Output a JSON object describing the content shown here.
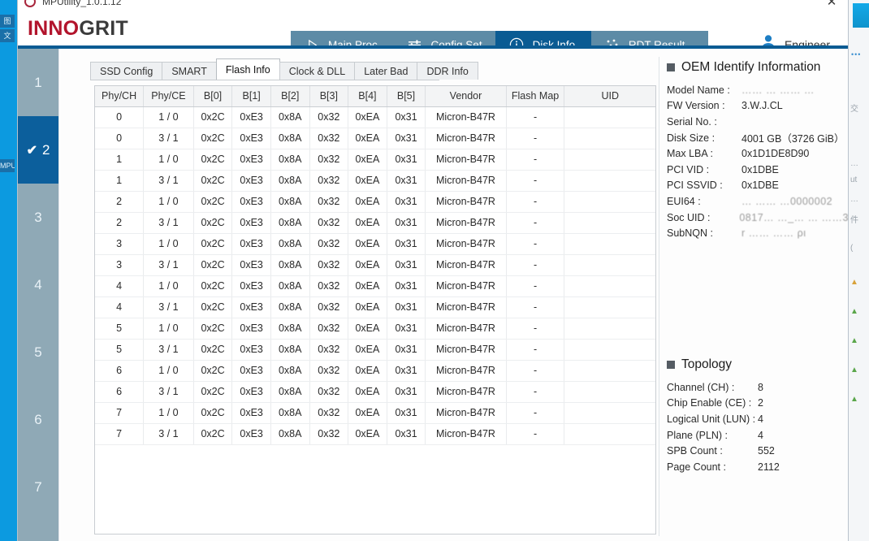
{
  "window": {
    "title": "MPUtility_1.0.1.12",
    "close_label": "✕",
    "logo_red": "INNO",
    "logo_dark": "GRIT"
  },
  "nav": {
    "tabs": [
      {
        "label": "Main Proc.",
        "icon": "play-icon",
        "active": false
      },
      {
        "label": "Config Set",
        "icon": "sliders-icon",
        "active": false
      },
      {
        "label": "Disk Info.",
        "icon": "info-circle-icon",
        "active": true
      },
      {
        "label": "RDT Result",
        "icon": "scatter-dots-icon",
        "active": false
      }
    ],
    "user": {
      "label": "Engineer",
      "icon": "user-avatar-icon"
    }
  },
  "stepper": {
    "steps": [
      {
        "number": "1",
        "active": false,
        "check": ""
      },
      {
        "number": "2",
        "active": true,
        "check": "✔"
      },
      {
        "number": "3",
        "active": false,
        "check": ""
      },
      {
        "number": "4",
        "active": false,
        "check": ""
      },
      {
        "number": "5",
        "active": false,
        "check": ""
      },
      {
        "number": "6",
        "active": false,
        "check": ""
      },
      {
        "number": "7",
        "active": false,
        "check": ""
      }
    ]
  },
  "subtabs": [
    {
      "label": "SSD Config",
      "active": false
    },
    {
      "label": "SMART",
      "active": false
    },
    {
      "label": "Flash Info",
      "active": true
    },
    {
      "label": "Clock & DLL",
      "active": false
    },
    {
      "label": "Later Bad",
      "active": false
    },
    {
      "label": "DDR Info",
      "active": false
    }
  ],
  "flash_table": {
    "headers": [
      "Phy/CH",
      "Phy/CE",
      "B[0]",
      "B[1]",
      "B[2]",
      "B[3]",
      "B[4]",
      "B[5]",
      "Vendor",
      "Flash Map",
      "UID"
    ],
    "rows": [
      [
        "0",
        "1 / 0",
        "0x2C",
        "0xE3",
        "0x8A",
        "0x32",
        "0xEA",
        "0x31",
        "Micron-B47R",
        "-",
        ""
      ],
      [
        "0",
        "3 / 1",
        "0x2C",
        "0xE3",
        "0x8A",
        "0x32",
        "0xEA",
        "0x31",
        "Micron-B47R",
        "-",
        ""
      ],
      [
        "1",
        "1 / 0",
        "0x2C",
        "0xE3",
        "0x8A",
        "0x32",
        "0xEA",
        "0x31",
        "Micron-B47R",
        "-",
        ""
      ],
      [
        "1",
        "3 / 1",
        "0x2C",
        "0xE3",
        "0x8A",
        "0x32",
        "0xEA",
        "0x31",
        "Micron-B47R",
        "-",
        ""
      ],
      [
        "2",
        "1 / 0",
        "0x2C",
        "0xE3",
        "0x8A",
        "0x32",
        "0xEA",
        "0x31",
        "Micron-B47R",
        "-",
        ""
      ],
      [
        "2",
        "3 / 1",
        "0x2C",
        "0xE3",
        "0x8A",
        "0x32",
        "0xEA",
        "0x31",
        "Micron-B47R",
        "-",
        ""
      ],
      [
        "3",
        "1 / 0",
        "0x2C",
        "0xE3",
        "0x8A",
        "0x32",
        "0xEA",
        "0x31",
        "Micron-B47R",
        "-",
        ""
      ],
      [
        "3",
        "3 / 1",
        "0x2C",
        "0xE3",
        "0x8A",
        "0x32",
        "0xEA",
        "0x31",
        "Micron-B47R",
        "-",
        ""
      ],
      [
        "4",
        "1 / 0",
        "0x2C",
        "0xE3",
        "0x8A",
        "0x32",
        "0xEA",
        "0x31",
        "Micron-B47R",
        "-",
        ""
      ],
      [
        "4",
        "3 / 1",
        "0x2C",
        "0xE3",
        "0x8A",
        "0x32",
        "0xEA",
        "0x31",
        "Micron-B47R",
        "-",
        ""
      ],
      [
        "5",
        "1 / 0",
        "0x2C",
        "0xE3",
        "0x8A",
        "0x32",
        "0xEA",
        "0x31",
        "Micron-B47R",
        "-",
        ""
      ],
      [
        "5",
        "3 / 1",
        "0x2C",
        "0xE3",
        "0x8A",
        "0x32",
        "0xEA",
        "0x31",
        "Micron-B47R",
        "-",
        ""
      ],
      [
        "6",
        "1 / 0",
        "0x2C",
        "0xE3",
        "0x8A",
        "0x32",
        "0xEA",
        "0x31",
        "Micron-B47R",
        "-",
        ""
      ],
      [
        "6",
        "3 / 1",
        "0x2C",
        "0xE3",
        "0x8A",
        "0x32",
        "0xEA",
        "0x31",
        "Micron-B47R",
        "-",
        ""
      ],
      [
        "7",
        "1 / 0",
        "0x2C",
        "0xE3",
        "0x8A",
        "0x32",
        "0xEA",
        "0x31",
        "Micron-B47R",
        "-",
        ""
      ],
      [
        "7",
        "3 / 1",
        "0x2C",
        "0xE3",
        "0x8A",
        "0x32",
        "0xEA",
        "0x31",
        "Micron-B47R",
        "-",
        ""
      ]
    ]
  },
  "oem": {
    "title": "OEM Identify Information",
    "fields": [
      {
        "key": "Model Name :",
        "value": "…… … …… …",
        "redacted": true
      },
      {
        "key": "FW Version :",
        "value": "3.W.J.CL",
        "redacted": false
      },
      {
        "key": "Serial No. :",
        "value": "",
        "redacted": false
      },
      {
        "key": "Disk Size :",
        "value": "4001 GB（3726 GiB）",
        "redacted": false
      },
      {
        "key": "Max LBA :",
        "value": "0x1D1DE8D90",
        "redacted": false
      },
      {
        "key": "PCI VID :",
        "value": "0x1DBE",
        "redacted": false
      },
      {
        "key": "PCI SSVID :",
        "value": "0x1DBE",
        "redacted": false
      },
      {
        "key": "EUI64 :",
        "value": "… …… …0000002",
        "redacted": true
      },
      {
        "key": "Soc UID :",
        "value": "0817… …_… … ……3",
        "redacted": true
      },
      {
        "key": "SubNQN :",
        "value": "r      …… ……            ρι",
        "redacted": true
      }
    ]
  },
  "topology": {
    "title": "Topology",
    "fields": [
      {
        "key": "Channel (CH) :",
        "value": "8"
      },
      {
        "key": "Chip Enable (CE) :",
        "value": "2"
      },
      {
        "key": "Logical Unit (LUN) :",
        "value": "4"
      },
      {
        "key": "Plane (PLN) :",
        "value": "4"
      },
      {
        "key": "SPB Count :",
        "value": "552"
      },
      {
        "key": "Page Count :",
        "value": "2112"
      }
    ]
  },
  "background": {
    "left_chips": [
      "图",
      "文"
    ],
    "right_labels": [
      "交",
      "…",
      "ut",
      "…",
      "件",
      "(",
      "▲",
      "▲",
      "▲",
      "▲",
      "▲"
    ]
  },
  "colors": {
    "brand_red": "#b2142c",
    "nav_bg": "#5d8ba6",
    "nav_active": "#0a5b93",
    "step_bg": "#8fa9b6",
    "step_active": "#0c5f9c"
  }
}
